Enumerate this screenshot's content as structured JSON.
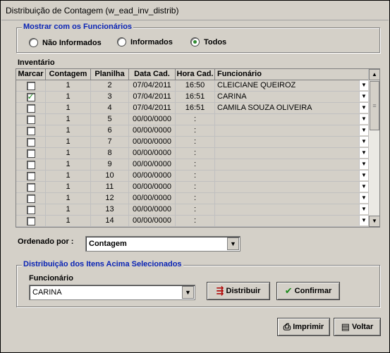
{
  "window": {
    "title": "Distribuição de Contagem (w_ead_inv_distrib)"
  },
  "filter": {
    "title": "Mostrar com os Funcionários",
    "options": [
      {
        "label": "Não Informados",
        "checked": false
      },
      {
        "label": "Informados",
        "checked": false
      },
      {
        "label": "Todos",
        "checked": true
      }
    ]
  },
  "inventory": {
    "title": "Inventário",
    "columns": [
      "Marcar",
      "Contagem",
      "Planilha",
      "Data Cad.",
      "Hora Cad.",
      "Funcionário"
    ],
    "rows": [
      {
        "checked": false,
        "contagem": "1",
        "planilha": "2",
        "data": "07/04/2011",
        "hora": "16:50",
        "funcionario": "CLEICIANE QUEIROZ"
      },
      {
        "checked": true,
        "contagem": "1",
        "planilha": "3",
        "data": "07/04/2011",
        "hora": "16:51",
        "funcionario": "CARINA"
      },
      {
        "checked": false,
        "contagem": "1",
        "planilha": "4",
        "data": "07/04/2011",
        "hora": "16:51",
        "funcionario": "CAMILA SOUZA OLIVEIRA"
      },
      {
        "checked": false,
        "contagem": "1",
        "planilha": "5",
        "data": "00/00/0000",
        "hora": ":",
        "funcionario": ""
      },
      {
        "checked": false,
        "contagem": "1",
        "planilha": "6",
        "data": "00/00/0000",
        "hora": ":",
        "funcionario": ""
      },
      {
        "checked": false,
        "contagem": "1",
        "planilha": "7",
        "data": "00/00/0000",
        "hora": ":",
        "funcionario": ""
      },
      {
        "checked": false,
        "contagem": "1",
        "planilha": "8",
        "data": "00/00/0000",
        "hora": ":",
        "funcionario": ""
      },
      {
        "checked": false,
        "contagem": "1",
        "planilha": "9",
        "data": "00/00/0000",
        "hora": ":",
        "funcionario": ""
      },
      {
        "checked": false,
        "contagem": "1",
        "planilha": "10",
        "data": "00/00/0000",
        "hora": ":",
        "funcionario": ""
      },
      {
        "checked": false,
        "contagem": "1",
        "planilha": "11",
        "data": "00/00/0000",
        "hora": ":",
        "funcionario": ""
      },
      {
        "checked": false,
        "contagem": "1",
        "planilha": "12",
        "data": "00/00/0000",
        "hora": ":",
        "funcionario": ""
      },
      {
        "checked": false,
        "contagem": "1",
        "planilha": "13",
        "data": "00/00/0000",
        "hora": ":",
        "funcionario": ""
      },
      {
        "checked": false,
        "contagem": "1",
        "planilha": "14",
        "data": "00/00/0000",
        "hora": ":",
        "funcionario": ""
      }
    ]
  },
  "order": {
    "label": "Ordenado por :",
    "value": "Contagem"
  },
  "distribution": {
    "title": "Distribuição dos Itens Acima Selecionados",
    "employee_label": "Funcionário",
    "employee_value": "CARINA",
    "distribute_label": "Distribuir",
    "confirm_label": "Confirmar"
  },
  "footer": {
    "print_label": "Imprimir",
    "back_label": "Voltar"
  },
  "colors": {
    "group_title": "#0a24b5",
    "panel": "#d4d0c8",
    "check": "#1a8a1a"
  }
}
